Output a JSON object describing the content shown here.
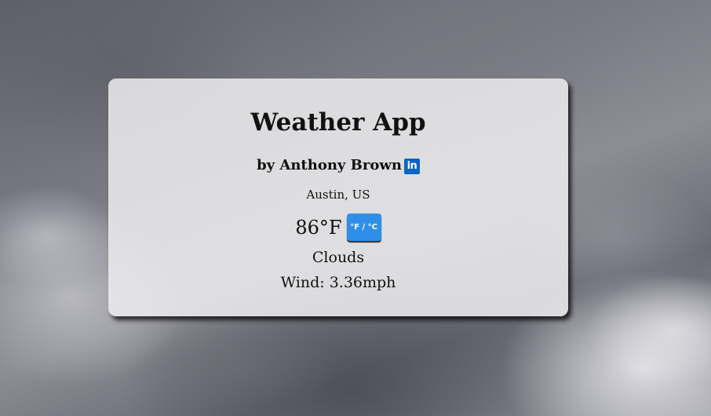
{
  "app": {
    "title": "Weather App",
    "byline": "by Anthony Brown",
    "linkedin_icon": "linkedin-icon",
    "linkedin_glyph": "in"
  },
  "weather": {
    "location": "Austin, US",
    "temperature": "86°F",
    "unit_toggle_label": "°F / °C",
    "conditions": "Clouds",
    "wind": "Wind: 3.36mph"
  },
  "colors": {
    "toggle_button": "#2f8fe8",
    "linkedin_brand": "#0a66c2"
  }
}
